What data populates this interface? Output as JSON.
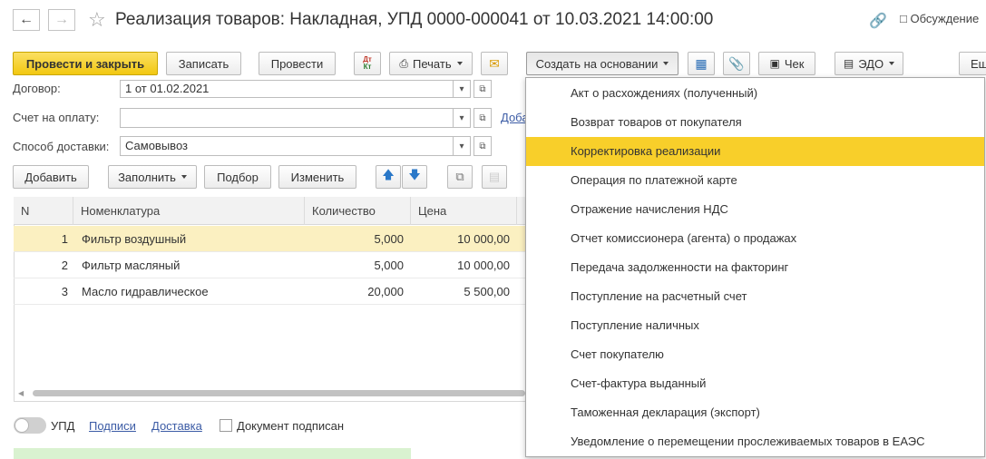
{
  "window": {
    "title": "Реализация товаров: Накладная, УПД 0000-000041 от 10.03.2021 14:00:00",
    "discussions_label": "Обсуждение"
  },
  "toolbar": {
    "post_close_label": "Провести и закрыть",
    "save_label": "Записать",
    "post_label": "Провести",
    "dt_kt_label": "Дт Кт",
    "print_label": "Печать",
    "create_based_label": "Создать на основании",
    "check_label": "Чек",
    "edo_label": "ЭДО",
    "more_label": "Еш"
  },
  "form": {
    "contract_label": "Договор:",
    "contract_value": "1 от 01.02.2021",
    "invoice_label": "Счет на оплату:",
    "invoice_value": "",
    "invoice_link": "Доба",
    "delivery_label": "Способ доставки:",
    "delivery_value": "Самовывоз"
  },
  "table_toolbar": {
    "add_label": "Добавить",
    "fill_label": "Заполнить",
    "pick_label": "Подбор",
    "change_label": "Изменить"
  },
  "table": {
    "columns": [
      "N",
      "Номенклатура",
      "Количество",
      "Цена"
    ],
    "rows": [
      {
        "n": "1",
        "name": "Фильтр воздушный",
        "qty": "5,000",
        "price": "10 000,00"
      },
      {
        "n": "2",
        "name": "Фильтр масляный",
        "qty": "5,000",
        "price": "10 000,00"
      },
      {
        "n": "3",
        "name": "Масло гидравлическое",
        "qty": "20,000",
        "price": "5 500,00"
      }
    ],
    "selected_row": 0
  },
  "footer": {
    "upd_label": "УПД",
    "signatures_link": "Подписи",
    "delivery_link": "Доставка",
    "signed_label": "Документ подписан"
  },
  "dropdown": {
    "items": [
      "Акт о расхождениях (полученный)",
      "Возврат товаров от покупателя",
      "Корректировка реализации",
      "Операция по платежной карте",
      "Отражение начисления НДС",
      "Отчет комиссионера (агента) о продажах",
      "Передача задолженности на факторинг",
      "Поступление на расчетный счет",
      "Поступление наличных",
      "Счет покупателю",
      "Счет-фактура выданный",
      "Таможенная декларация (экспорт)",
      "Уведомление о перемещении прослеживаемых товаров в ЕАЭС"
    ],
    "highlighted_index": 2
  },
  "colors": {
    "primary_button": "#f2c811",
    "selected_row": "#fbf0c1",
    "menu_highlight": "#f8cf2a",
    "link": "#3b5ba5",
    "info_bar": "#d9f2d0"
  }
}
